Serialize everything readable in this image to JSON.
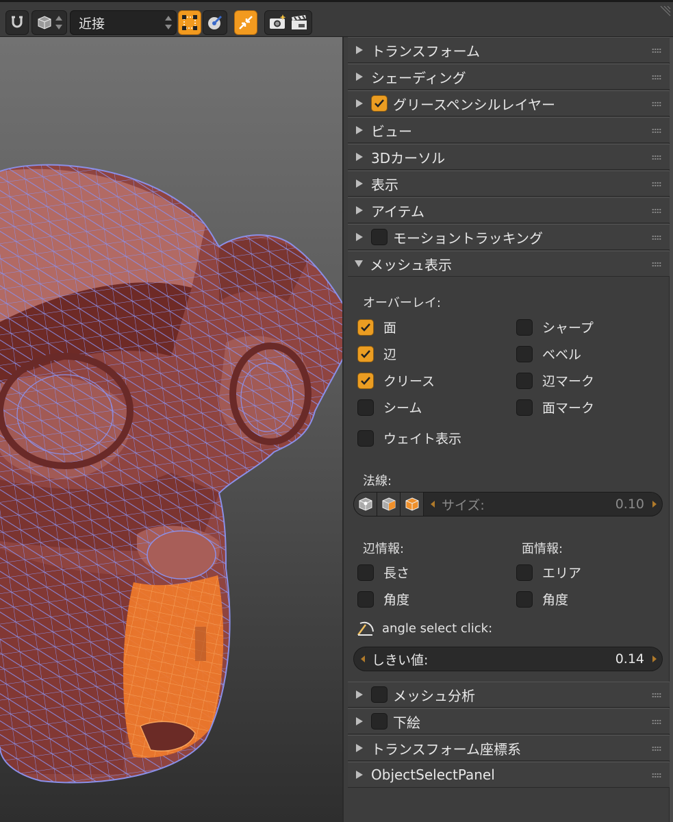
{
  "header": {
    "snap_element": "近接",
    "icons": [
      "magnet-icon",
      "cube-icon",
      "snap-target-icon",
      "snap-rotate-icon",
      "snap-align-icon",
      "render-image-icon",
      "render-animation-icon"
    ]
  },
  "colors": {
    "accent": "#f29a1f",
    "mesh_face": "#9b4a44",
    "mesh_wire": "#7f86e0",
    "selected_face": "#f07a2a"
  },
  "panel": {
    "sections_top": [
      {
        "label": "トランスフォーム",
        "checkbox": null
      },
      {
        "label": "シェーディング",
        "checkbox": null
      },
      {
        "label": "グリースペンシルレイヤー",
        "checkbox": true
      },
      {
        "label": "ビュー",
        "checkbox": null
      },
      {
        "label": "3Dカーソル",
        "checkbox": null
      },
      {
        "label": "表示",
        "checkbox": null
      },
      {
        "label": "アイテム",
        "checkbox": null
      },
      {
        "label": "モーショントラッキング",
        "checkbox": false
      },
      {
        "label": "メッシュ表示",
        "checkbox": null
      }
    ],
    "mesh_display": {
      "overlay_label": "オーバーレイ:",
      "overlay_left": [
        {
          "label": "面",
          "checked": true
        },
        {
          "label": "辺",
          "checked": true
        },
        {
          "label": "クリース",
          "checked": true
        },
        {
          "label": "シーム",
          "checked": false
        },
        {
          "label": "ウェイト表示",
          "checked": false
        }
      ],
      "overlay_right": [
        {
          "label": "シャープ",
          "checked": false
        },
        {
          "label": "ベベル",
          "checked": false
        },
        {
          "label": "辺マーク",
          "checked": false
        },
        {
          "label": "面マーク",
          "checked": false
        }
      ],
      "normals_label": "法線:",
      "size_label": "サイズ:",
      "size_value": "0.10",
      "edge_info_label": "辺情報:",
      "face_info_label": "面情報:",
      "edge_info": [
        {
          "label": "長さ",
          "checked": false
        },
        {
          "label": "角度",
          "checked": false
        }
      ],
      "face_info": [
        {
          "label": "エリア",
          "checked": false
        },
        {
          "label": "角度",
          "checked": false
        }
      ],
      "operator_label": "angle select click:",
      "threshold_label": "しきい値:",
      "threshold_value": "0.14"
    },
    "sections_bottom": [
      {
        "label": "メッシュ分析",
        "checkbox": false
      },
      {
        "label": "下絵",
        "checkbox": false
      },
      {
        "label": "トランスフォーム座標系",
        "checkbox": null
      },
      {
        "label": "ObjectSelectPanel",
        "checkbox": null
      }
    ]
  }
}
